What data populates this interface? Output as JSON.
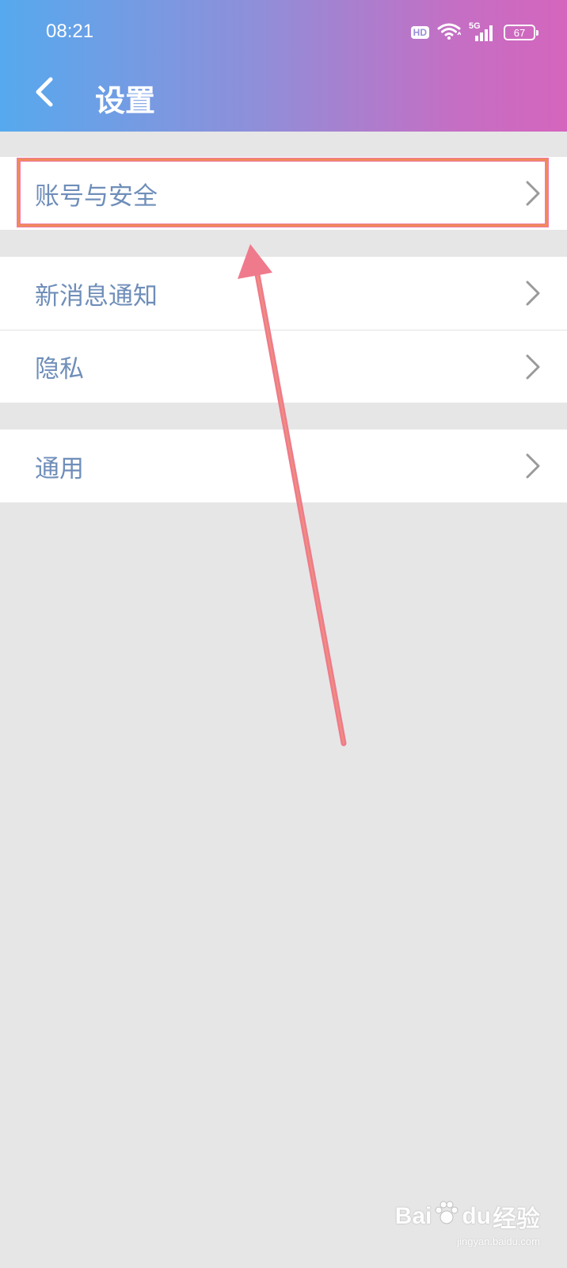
{
  "status_bar": {
    "time": "08:21",
    "hd_label": "HD",
    "network_label": "5G",
    "battery_level": "67",
    "icons": [
      "hd-icon",
      "wifi-icon",
      "signal-icon",
      "battery-icon"
    ]
  },
  "header": {
    "back_icon": "chevron-left-icon",
    "title": "设置"
  },
  "settings_groups": [
    {
      "items": [
        {
          "label": "账号与安全",
          "icon": "chevron-right-icon",
          "highlighted": true
        }
      ]
    },
    {
      "items": [
        {
          "label": "新消息通知",
          "icon": "chevron-right-icon"
        },
        {
          "label": "隐私",
          "icon": "chevron-right-icon"
        }
      ]
    },
    {
      "items": [
        {
          "label": "通用",
          "icon": "chevron-right-icon"
        }
      ]
    }
  ],
  "annotation": {
    "highlight_color": "#f08a5a",
    "arrow_color": "#ef7a8c"
  },
  "watermark": {
    "logo_text_left": "Bai",
    "logo_text_mid": "du",
    "logo_text_right": "经验",
    "url": "jingyan.baidu.com"
  },
  "colors": {
    "header_gradient_start": "#56a9ee",
    "header_gradient_end": "#d565bd",
    "label_text": "#6f8eb9",
    "background": "#e6e6e6"
  }
}
